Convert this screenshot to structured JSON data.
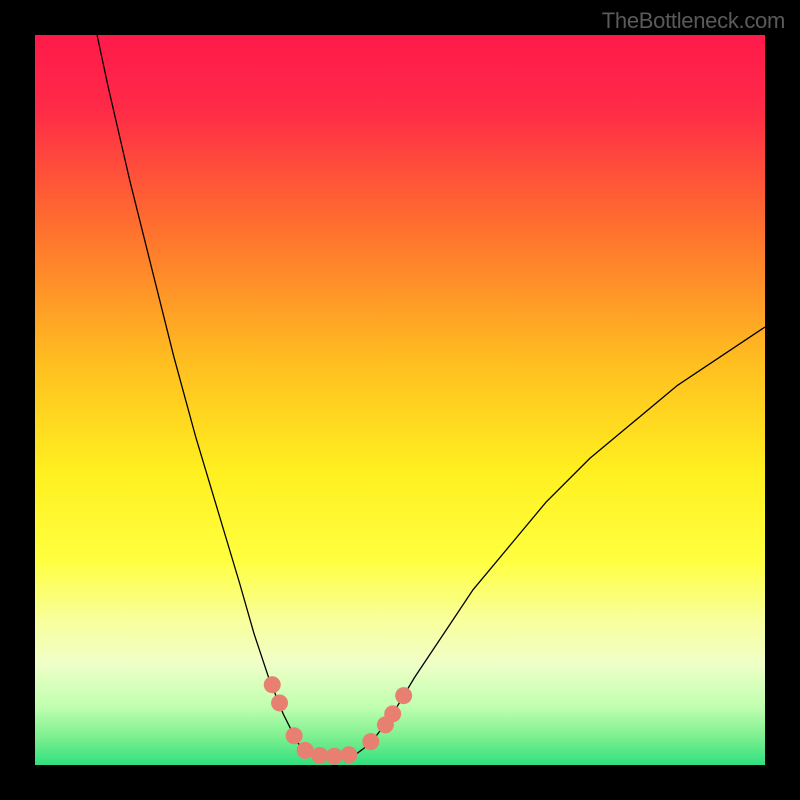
{
  "watermark": "TheBottleneck.com",
  "chart_data": {
    "type": "line",
    "title": "",
    "xlabel": "",
    "ylabel": "",
    "xlim": [
      0,
      100
    ],
    "ylim": [
      0,
      100
    ],
    "background_gradient": {
      "stops": [
        {
          "offset": 0,
          "color": "#ff1a4a"
        },
        {
          "offset": 10,
          "color": "#ff2a48"
        },
        {
          "offset": 25,
          "color": "#ff6a30"
        },
        {
          "offset": 45,
          "color": "#ffbf20"
        },
        {
          "offset": 60,
          "color": "#fff020"
        },
        {
          "offset": 72,
          "color": "#ffff40"
        },
        {
          "offset": 80,
          "color": "#f8ff9a"
        },
        {
          "offset": 86,
          "color": "#f0ffc8"
        },
        {
          "offset": 92,
          "color": "#c0ffb0"
        },
        {
          "offset": 96,
          "color": "#80f090"
        },
        {
          "offset": 100,
          "color": "#30e080"
        }
      ]
    },
    "curve": [
      {
        "x": 8.5,
        "y": 100
      },
      {
        "x": 10,
        "y": 93
      },
      {
        "x": 13,
        "y": 80
      },
      {
        "x": 16,
        "y": 68
      },
      {
        "x": 19,
        "y": 56
      },
      {
        "x": 22,
        "y": 45
      },
      {
        "x": 25,
        "y": 35
      },
      {
        "x": 28,
        "y": 25
      },
      {
        "x": 30,
        "y": 18
      },
      {
        "x": 32,
        "y": 12
      },
      {
        "x": 34,
        "y": 7
      },
      {
        "x": 36,
        "y": 3
      },
      {
        "x": 38,
        "y": 1.2
      },
      {
        "x": 40,
        "y": 1
      },
      {
        "x": 42,
        "y": 1
      },
      {
        "x": 44,
        "y": 1.5
      },
      {
        "x": 46,
        "y": 3
      },
      {
        "x": 49,
        "y": 7
      },
      {
        "x": 52,
        "y": 12
      },
      {
        "x": 56,
        "y": 18
      },
      {
        "x": 60,
        "y": 24
      },
      {
        "x": 65,
        "y": 30
      },
      {
        "x": 70,
        "y": 36
      },
      {
        "x": 76,
        "y": 42
      },
      {
        "x": 82,
        "y": 47
      },
      {
        "x": 88,
        "y": 52
      },
      {
        "x": 94,
        "y": 56
      },
      {
        "x": 100,
        "y": 60
      }
    ],
    "marker_points": [
      {
        "x": 32.5,
        "y": 11
      },
      {
        "x": 33.5,
        "y": 8.5
      },
      {
        "x": 35.5,
        "y": 4
      },
      {
        "x": 37,
        "y": 2
      },
      {
        "x": 39,
        "y": 1.3
      },
      {
        "x": 41,
        "y": 1.2
      },
      {
        "x": 43,
        "y": 1.4
      },
      {
        "x": 46,
        "y": 3.2
      },
      {
        "x": 48,
        "y": 5.5
      },
      {
        "x": 49,
        "y": 7
      },
      {
        "x": 50.5,
        "y": 9.5
      }
    ],
    "marker_color": "#e88072",
    "curve_color": "#000000",
    "curve_width": 1.3
  }
}
